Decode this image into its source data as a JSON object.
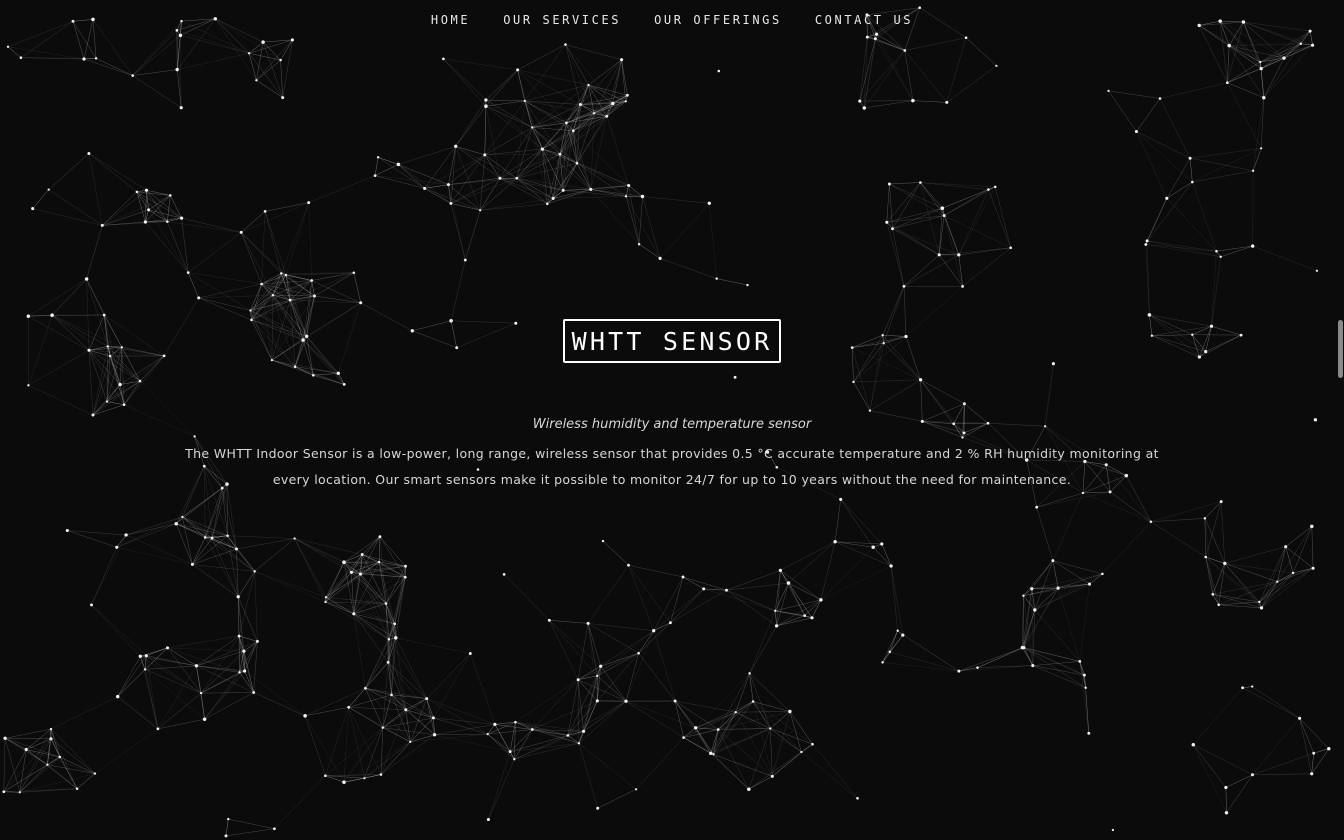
{
  "nav": {
    "items": [
      {
        "label": "HOME"
      },
      {
        "label": "OUR SERVICES"
      },
      {
        "label": "OUR OFFERINGS"
      },
      {
        "label": "CONTACT US"
      }
    ]
  },
  "hero": {
    "title": "WHTT SENSOR",
    "tagline": "Wireless humidity and temperature sensor",
    "description": "The WHTT Indoor Sensor is a low-power, long range, wireless sensor that provides 0.5 °C accurate temperature and 2 % RH humidity monitoring at every location. Our smart sensors make it possible to monitor 24/7 for up to 10 years without the need for maintenance."
  },
  "theme": {
    "background": "#0b0b0c",
    "text": "#e6e6e6",
    "accent": "#ffffff"
  }
}
